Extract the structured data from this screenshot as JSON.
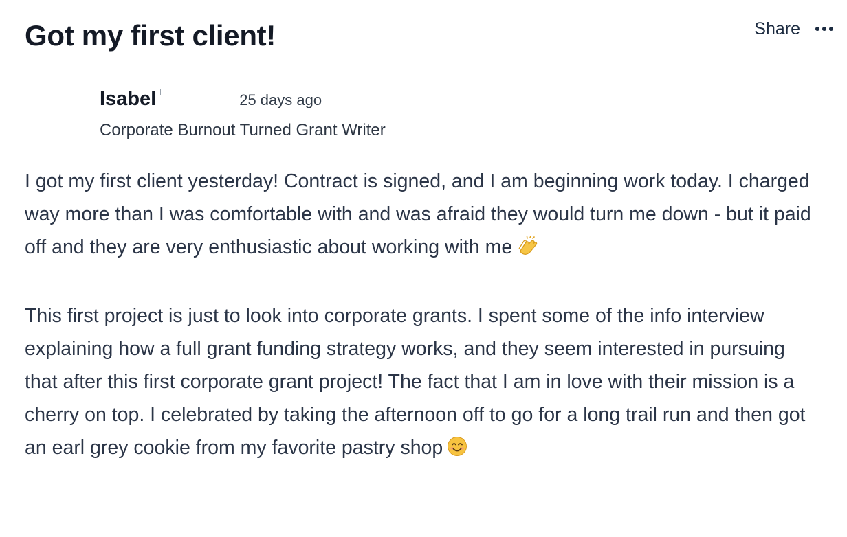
{
  "post": {
    "title": "Got my first client!",
    "actions": {
      "share_label": "Share",
      "more_icon": "more-horizontal-icon"
    },
    "author": {
      "name": "Isabel",
      "time": "25 days ago",
      "tagline": "Corporate Burnout Turned Grant Writer"
    },
    "body": {
      "paragraph_1": "I got my first client yesterday! Contract is signed, and I am beginning work today. I charged way more than I was comfortable with and was afraid they would turn me down - but it paid off and they are very enthusiastic about working with me",
      "paragraph_1_emoji": "clapping-hands-icon",
      "paragraph_2": "This first project is just to look into corporate grants. I spent some of the info interview explaining how a full grant funding strategy works, and they seem interested in pursuing that after this first corporate grant project! The fact that I am in love with their mission is a cherry on top. I celebrated by taking the afternoon off to go for a long trail run and then got an earl grey cookie from my favorite pastry shop",
      "paragraph_2_emoji": "smiling-face-icon"
    }
  },
  "colors": {
    "title": "#141a26",
    "body_text": "#2b3547",
    "background": "#ffffff"
  }
}
